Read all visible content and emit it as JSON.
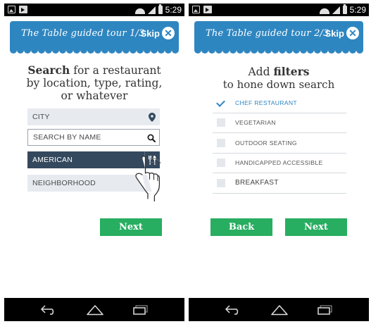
{
  "status_bar": {
    "time": "5:29"
  },
  "screen1": {
    "banner_title": "The Table guided tour 1/3",
    "skip_label": "Skip",
    "headline_bold": "Search",
    "headline_line1_rest": " for a restaurant",
    "headline_line2": "by location, type, rating,",
    "headline_line3": "or whatever",
    "fields": {
      "city": "CITY",
      "search_by_name": "SEARCH BY NAME",
      "type": "AMERICAN",
      "neighborhood": "NEIGHBORHOOD"
    },
    "next_label": "Next"
  },
  "screen2": {
    "banner_title": "The Table guided tour 2/3",
    "skip_label": "Skip",
    "headline_pre": "Add ",
    "headline_bold": "filters",
    "subtitle": "to hone down search",
    "filters": [
      {
        "label": "CHEF RESTAURANT",
        "checked": true
      },
      {
        "label": "VEGETARIAN",
        "checked": false
      },
      {
        "label": "OUTDOOR SEATING",
        "checked": false
      },
      {
        "label": "HANDICAPPED ACCESSIBLE",
        "checked": false
      },
      {
        "label": "BREAKFAST",
        "checked": false
      }
    ],
    "back_label": "Back",
    "next_label": "Next"
  },
  "colors": {
    "banner": "#2e86c1",
    "button": "#27ae60",
    "selected_field": "#34495e",
    "field_bg": "#e7ebef"
  },
  "icons": [
    "image-icon",
    "cast-icon",
    "wifi-icon",
    "signal-icon",
    "battery-icon",
    "close-icon",
    "location-pin-icon",
    "search-icon",
    "fork-knife-icon",
    "hand-pointer-icon",
    "back-icon",
    "home-icon",
    "recent-apps-icon",
    "checkmark-icon"
  ]
}
